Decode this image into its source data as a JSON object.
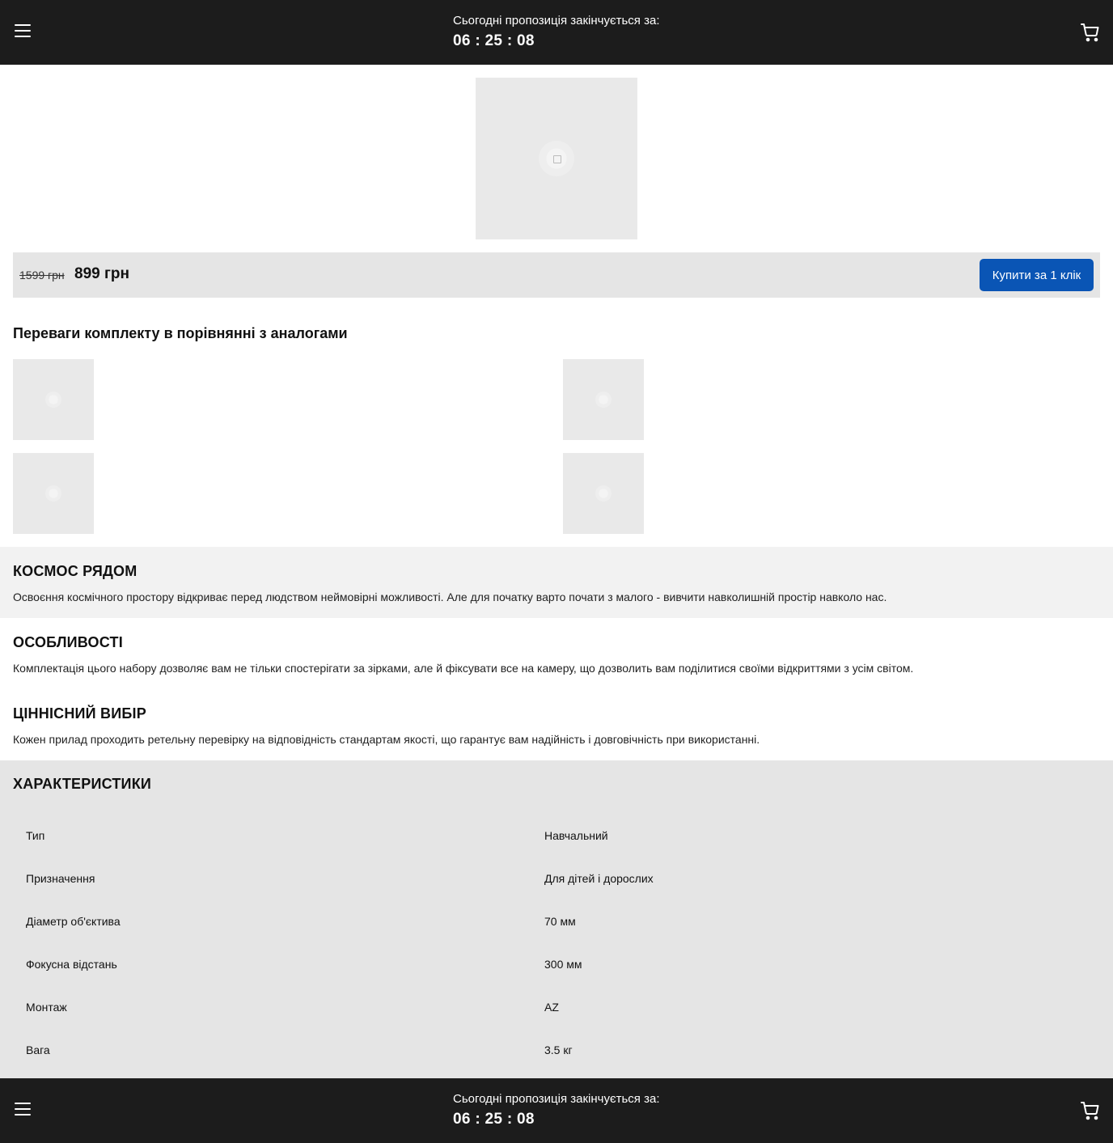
{
  "header": {
    "countdown_label": "Сьогодні пропозиція закінчується за:",
    "countdown_time": "06 : 25 : 08"
  },
  "pricing": {
    "old_price": "1599 грн",
    "new_price": "899 грн",
    "buy_label": "Купити за 1 клік"
  },
  "advantages": {
    "title": "Переваги комплекту в порівнянні з аналогами"
  },
  "sections": [
    {
      "title": "КОСМОС РЯДОМ",
      "text": "Освоєння космічного простору відкриває перед людством неймовірні можливості. Але для початку варто почати з малого - вивчити навколишній простір навколо нас."
    },
    {
      "title": "ОСОБЛИВОСТІ",
      "text": "Комплектація цього набору дозволяє вам не тільки спостерігати за зірками, але й фіксувати все на камеру, що дозволить вам поділитися своїми відкриттями з усім світом."
    },
    {
      "title": "ЦІННІСНИЙ ВИБІР",
      "text": "Кожен прилад проходить ретельну перевірку на відповідність стандартам якості, що гарантує вам надійність і довговічність при використанні."
    }
  ],
  "specs": {
    "title": "ХАРАКТЕРИСТИКИ",
    "rows": [
      {
        "key": "Тип",
        "value": "Навчальний"
      },
      {
        "key": "Призначення",
        "value": "Для дітей і дорослих"
      },
      {
        "key": "Діаметр об'єктива",
        "value": "70 мм"
      },
      {
        "key": "Фокусна відстань",
        "value": "300 мм"
      },
      {
        "key": "Монтаж",
        "value": "AZ"
      },
      {
        "key": "Вага",
        "value": "3.5 кг"
      }
    ]
  },
  "colors": {
    "bar_background": "#1c1c1c",
    "accent": "#0a55b5"
  },
  "icons": {
    "menu": "hamburger-menu-icon",
    "cart": "shopping-cart-icon",
    "image": "image-placeholder-icon"
  }
}
